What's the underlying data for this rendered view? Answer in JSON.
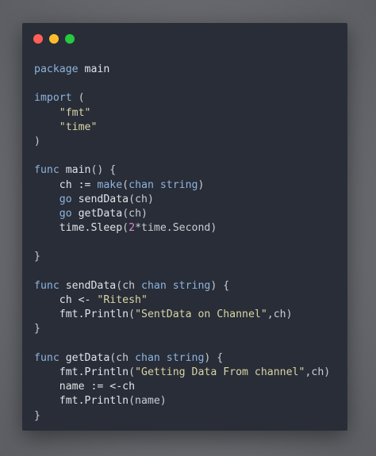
{
  "window": {
    "controls": [
      {
        "name": "close",
        "color": "#ff5f56"
      },
      {
        "name": "minimize",
        "color": "#ffbd2e"
      },
      {
        "name": "maximize",
        "color": "#27c93f"
      }
    ]
  },
  "code": {
    "lines": [
      [
        {
          "t": "package",
          "c": "kw"
        },
        {
          "t": " main",
          "c": "id"
        }
      ],
      [],
      [
        {
          "t": "import",
          "c": "kw"
        },
        {
          "t": " (",
          "c": "op"
        }
      ],
      [
        {
          "t": "    ",
          "c": "op"
        },
        {
          "t": "\"fmt\"",
          "c": "str"
        }
      ],
      [
        {
          "t": "    ",
          "c": "op"
        },
        {
          "t": "\"time\"",
          "c": "str"
        }
      ],
      [
        {
          "t": ")",
          "c": "op"
        }
      ],
      [],
      [
        {
          "t": "func",
          "c": "kw"
        },
        {
          "t": " ",
          "c": "op"
        },
        {
          "t": "main",
          "c": "fn"
        },
        {
          "t": "() {",
          "c": "op"
        }
      ],
      [
        {
          "t": "    ch := ",
          "c": "id"
        },
        {
          "t": "make",
          "c": "kw"
        },
        {
          "t": "(",
          "c": "op"
        },
        {
          "t": "chan",
          "c": "kw"
        },
        {
          "t": " ",
          "c": "op"
        },
        {
          "t": "string",
          "c": "kw"
        },
        {
          "t": ")",
          "c": "op"
        }
      ],
      [
        {
          "t": "    ",
          "c": "op"
        },
        {
          "t": "go",
          "c": "kw"
        },
        {
          "t": " ",
          "c": "op"
        },
        {
          "t": "sendData",
          "c": "fn"
        },
        {
          "t": "(ch)",
          "c": "op"
        }
      ],
      [
        {
          "t": "    ",
          "c": "op"
        },
        {
          "t": "go",
          "c": "kw"
        },
        {
          "t": " ",
          "c": "op"
        },
        {
          "t": "getData",
          "c": "fn"
        },
        {
          "t": "(ch)",
          "c": "op"
        }
      ],
      [
        {
          "t": "    time.",
          "c": "id"
        },
        {
          "t": "Sleep",
          "c": "fn"
        },
        {
          "t": "(",
          "c": "op"
        },
        {
          "t": "2",
          "c": "num"
        },
        {
          "t": "*time.Second)",
          "c": "op"
        }
      ],
      [],
      [
        {
          "t": "}",
          "c": "op"
        }
      ],
      [],
      [
        {
          "t": "func",
          "c": "kw"
        },
        {
          "t": " ",
          "c": "op"
        },
        {
          "t": "sendData",
          "c": "fn"
        },
        {
          "t": "(ch ",
          "c": "op"
        },
        {
          "t": "chan",
          "c": "kw"
        },
        {
          "t": " ",
          "c": "op"
        },
        {
          "t": "string",
          "c": "kw"
        },
        {
          "t": ") {",
          "c": "op"
        }
      ],
      [
        {
          "t": "    ch <- ",
          "c": "id"
        },
        {
          "t": "\"Ritesh\"",
          "c": "str"
        }
      ],
      [
        {
          "t": "    fmt.",
          "c": "id"
        },
        {
          "t": "Println",
          "c": "fn"
        },
        {
          "t": "(",
          "c": "op"
        },
        {
          "t": "\"SentData on Channel\"",
          "c": "str"
        },
        {
          "t": ",ch)",
          "c": "op"
        }
      ],
      [
        {
          "t": "}",
          "c": "op"
        }
      ],
      [],
      [
        {
          "t": "func",
          "c": "kw"
        },
        {
          "t": " ",
          "c": "op"
        },
        {
          "t": "getData",
          "c": "fn"
        },
        {
          "t": "(ch ",
          "c": "op"
        },
        {
          "t": "chan",
          "c": "kw"
        },
        {
          "t": " ",
          "c": "op"
        },
        {
          "t": "string",
          "c": "kw"
        },
        {
          "t": ") {",
          "c": "op"
        }
      ],
      [
        {
          "t": "    fmt.",
          "c": "id"
        },
        {
          "t": "Println",
          "c": "fn"
        },
        {
          "t": "(",
          "c": "op"
        },
        {
          "t": "\"Getting Data From channel\"",
          "c": "str"
        },
        {
          "t": ",ch)",
          "c": "op"
        }
      ],
      [
        {
          "t": "    name := <-ch",
          "c": "id"
        }
      ],
      [
        {
          "t": "    fmt.",
          "c": "id"
        },
        {
          "t": "Println",
          "c": "fn"
        },
        {
          "t": "(name)",
          "c": "op"
        }
      ],
      [
        {
          "t": "}",
          "c": "op"
        }
      ]
    ]
  }
}
